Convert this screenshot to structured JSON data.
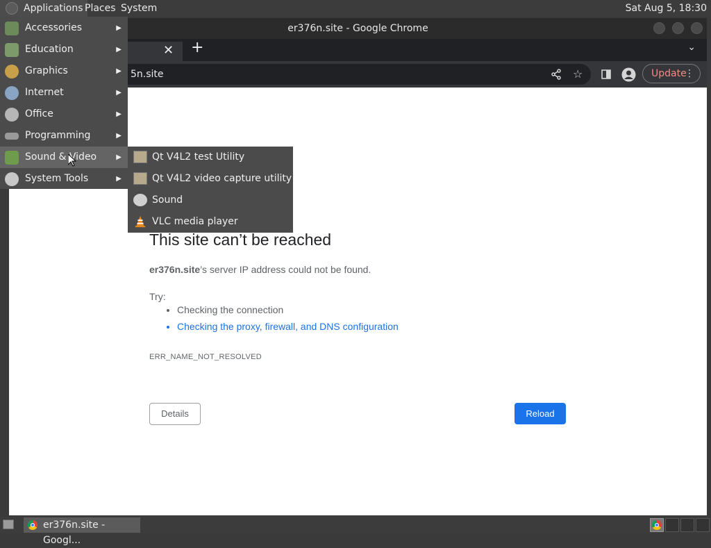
{
  "top_panel": {
    "menus": [
      "Applications",
      "Places",
      "System"
    ],
    "clock": "Sat Aug  5, 18:30"
  },
  "window": {
    "title": "er376n.site - Google Chrome",
    "url": "5n.site",
    "update_label": "Update"
  },
  "error_page": {
    "title": "This site can’t be reached",
    "host": "er376n.site",
    "description": "’s server IP address could not be found.",
    "try_label": "Try:",
    "suggestions": [
      "Checking the connection",
      "Checking the proxy, firewall, and DNS configuration"
    ],
    "error_code": "ERR_NAME_NOT_RESOLVED",
    "details_label": "Details",
    "reload_label": "Reload"
  },
  "apps_menu": {
    "items": [
      {
        "label": "Accessories",
        "icon": "accessories-icon"
      },
      {
        "label": "Education",
        "icon": "education-icon"
      },
      {
        "label": "Graphics",
        "icon": "graphics-icon"
      },
      {
        "label": "Internet",
        "icon": "internet-icon"
      },
      {
        "label": "Office",
        "icon": "office-icon"
      },
      {
        "label": "Programming",
        "icon": "programming-icon"
      },
      {
        "label": "Sound & Video",
        "icon": "sound-video-icon"
      },
      {
        "label": "System Tools",
        "icon": "system-tools-icon"
      }
    ],
    "active_index": 6
  },
  "sound_video_submenu": {
    "items": [
      {
        "label": "Qt V4L2 test Utility",
        "icon": "qv4l2-icon"
      },
      {
        "label": "Qt V4L2 video capture utility",
        "icon": "qvidcap-icon"
      },
      {
        "label": "Sound",
        "icon": "sound-icon"
      },
      {
        "label": "VLC media player",
        "icon": "vlc-icon"
      }
    ]
  },
  "taskbar": {
    "window_button": "er376n.site - Googl..."
  },
  "colors": {
    "link": "#1a73e8",
    "reload_button": "#1a73e8",
    "update_text": "#f28b82"
  }
}
